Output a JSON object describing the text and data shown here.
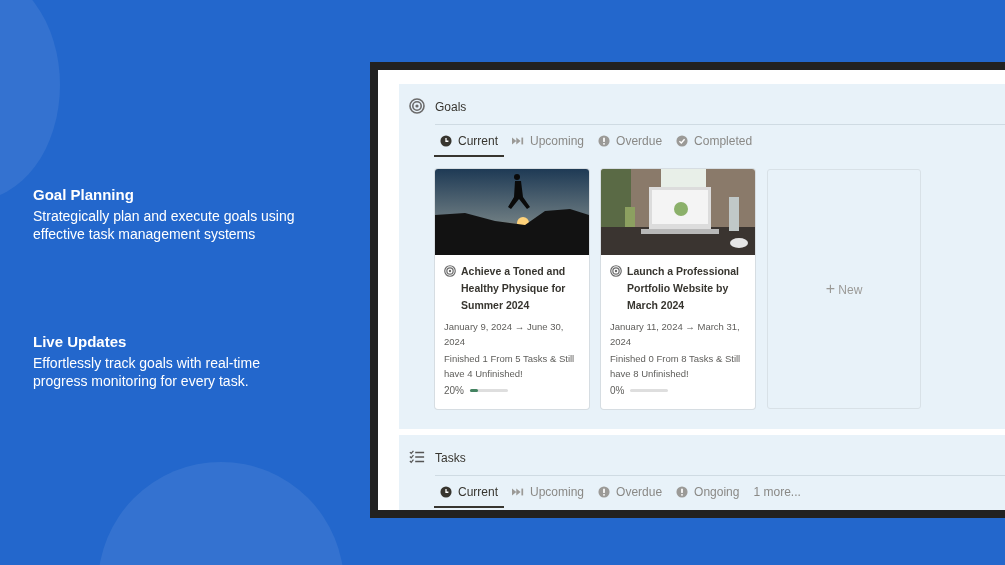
{
  "features": [
    {
      "title": "Goal Planning",
      "text": "Strategically plan and execute goals using effective task management systems"
    },
    {
      "title": "Live Updates",
      "text": "Effortlessly track goals with real-time progress monitoring for every task."
    }
  ],
  "goals": {
    "title": "Goals",
    "tabs": [
      {
        "label": "Current",
        "kind": "clock",
        "selected": true
      },
      {
        "label": "Upcoming",
        "kind": "forward",
        "selected": false
      },
      {
        "label": "Overdue",
        "kind": "alert",
        "selected": false
      },
      {
        "label": "Completed",
        "kind": "check",
        "selected": false
      }
    ],
    "cards": [
      {
        "title": "Achieve a Toned and Healthy Physique for Summer 2024",
        "dates": "January 9, 2024 → June 30, 2024",
        "status": "Finished 1 From 5 Tasks & Still have 4 Unfinished!",
        "percent": "20%",
        "level": 0.2
      },
      {
        "title": "Launch a Professional Portfolio Website by March 2024",
        "dates": "January 11, 2024 → March 31, 2024",
        "status": "Finished 0 From 8 Tasks & Still have 8 Unfinished!",
        "percent": "0%",
        "level": 0
      }
    ],
    "new_card": {
      "icon": "+",
      "label": "New"
    }
  },
  "tasks": {
    "title": "Tasks",
    "tabs": [
      {
        "label": "Current",
        "kind": "clock",
        "selected": true
      },
      {
        "label": "Upcoming",
        "kind": "forward",
        "selected": false
      },
      {
        "label": "Overdue",
        "kind": "alert",
        "selected": false
      },
      {
        "label": "Ongoing",
        "kind": "alert",
        "selected": false
      },
      {
        "label": "1 more...",
        "kind": "text",
        "selected": false
      }
    ]
  }
}
